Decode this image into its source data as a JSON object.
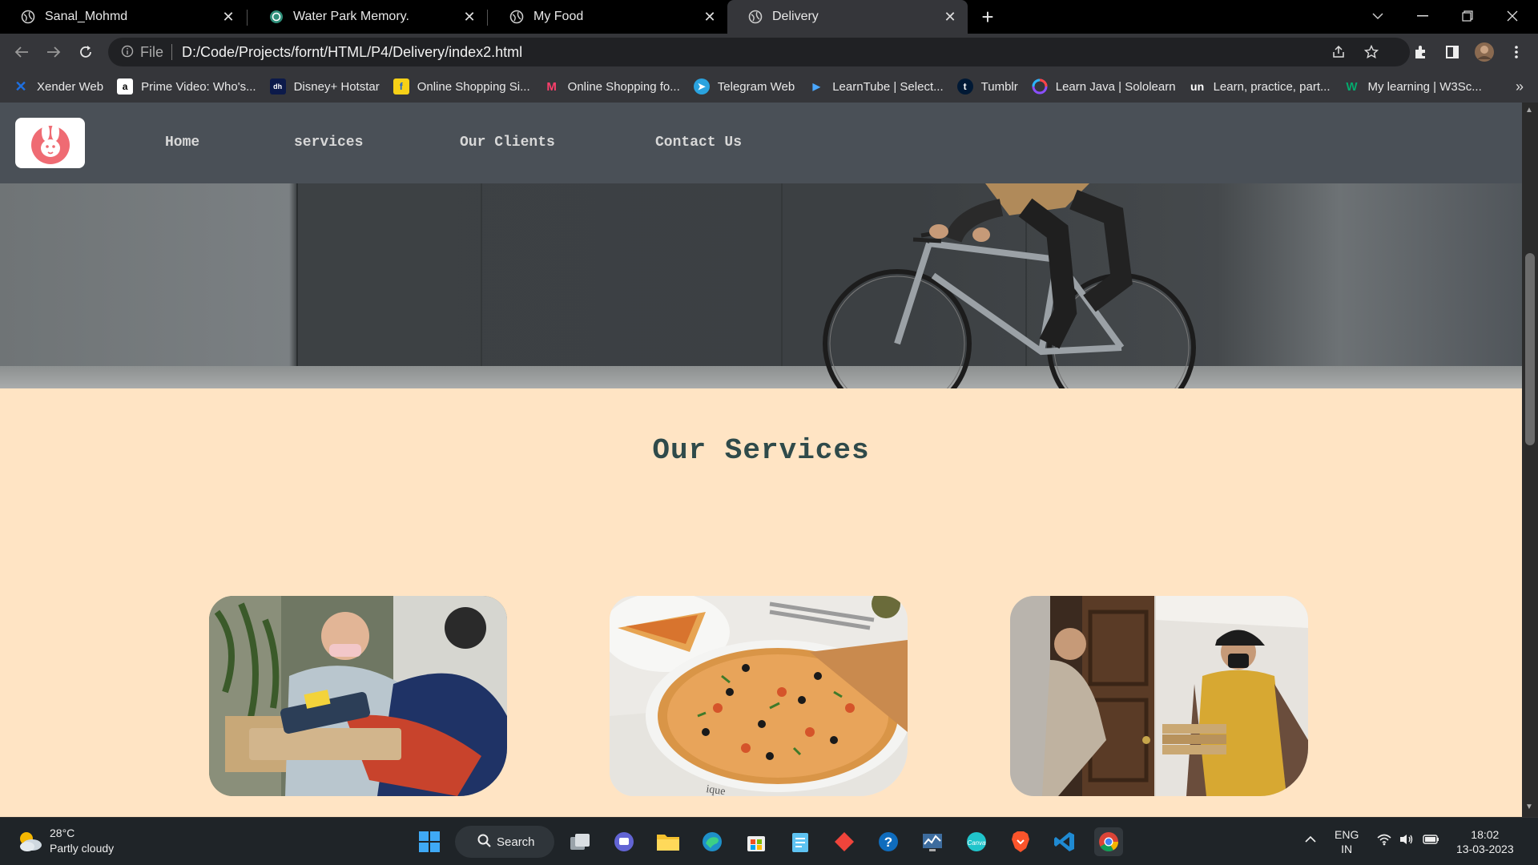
{
  "browser": {
    "tabs": [
      {
        "title": "Sanal_Mohmd",
        "icon": "globe-icon",
        "active": false
      },
      {
        "title": "Water Park Memory.",
        "icon": "chatgpt-icon",
        "active": false
      },
      {
        "title": "My Food",
        "icon": "globe-icon",
        "active": false
      },
      {
        "title": "Delivery",
        "icon": "globe-icon",
        "active": true
      }
    ],
    "address": {
      "scheme_label": "File",
      "url": "D:/Code/Projects/fornt/HTML/P4/Delivery/index2.html"
    },
    "bookmarks": [
      {
        "label": "Xender Web",
        "icon": "xender-icon",
        "color": "#1e6fe0"
      },
      {
        "label": "Prime Video: Who's...",
        "icon": "amazon-icon",
        "color": "#ffffff"
      },
      {
        "label": "Disney+ Hotstar",
        "icon": "hotstar-icon",
        "color": "#0c1a4a"
      },
      {
        "label": "Online Shopping Si...",
        "icon": "flipkart-icon",
        "color": "#f7d117"
      },
      {
        "label": "Online Shopping fo...",
        "icon": "myntra-icon",
        "color": "#ff3f6c"
      },
      {
        "label": "Telegram Web",
        "icon": "telegram-icon",
        "color": "#2aa3df"
      },
      {
        "label": "LearnTube | Select...",
        "icon": "learntube-icon",
        "color": "#3a7bd5"
      },
      {
        "label": "Tumblr",
        "icon": "tumblr-icon",
        "color": "#001935"
      },
      {
        "label": "Learn Java | Sololearn",
        "icon": "sololearn-icon",
        "color": "#8a4fff"
      },
      {
        "label": "Learn, practice, part...",
        "icon": "unstop-icon",
        "color": "#1c4980"
      },
      {
        "label": "My learning | W3Sc...",
        "icon": "w3schools-icon",
        "color": "#04aa6d"
      }
    ],
    "bookmarks_more": "»"
  },
  "site": {
    "nav": [
      {
        "label": "Home"
      },
      {
        "label": "services"
      },
      {
        "label": "Our Clients"
      },
      {
        "label": "Contact Us"
      }
    ],
    "services_title": "Our Services",
    "cards": [
      {
        "subject": "card-payment-delivery-photo"
      },
      {
        "subject": "pizza-photo"
      },
      {
        "subject": "doorstep-pizza-delivery-photo"
      }
    ],
    "colors": {
      "page_bg": "#ffe4c4",
      "nav_bg": "#4a5057",
      "title": "#2f4a4a"
    }
  },
  "taskbar": {
    "weather": {
      "temp": "28°C",
      "condition": "Partly cloudy"
    },
    "search_label": "Search",
    "language": {
      "lang": "ENG",
      "region": "IN"
    },
    "clock": {
      "time": "18:02",
      "date": "13-03-2023"
    }
  }
}
